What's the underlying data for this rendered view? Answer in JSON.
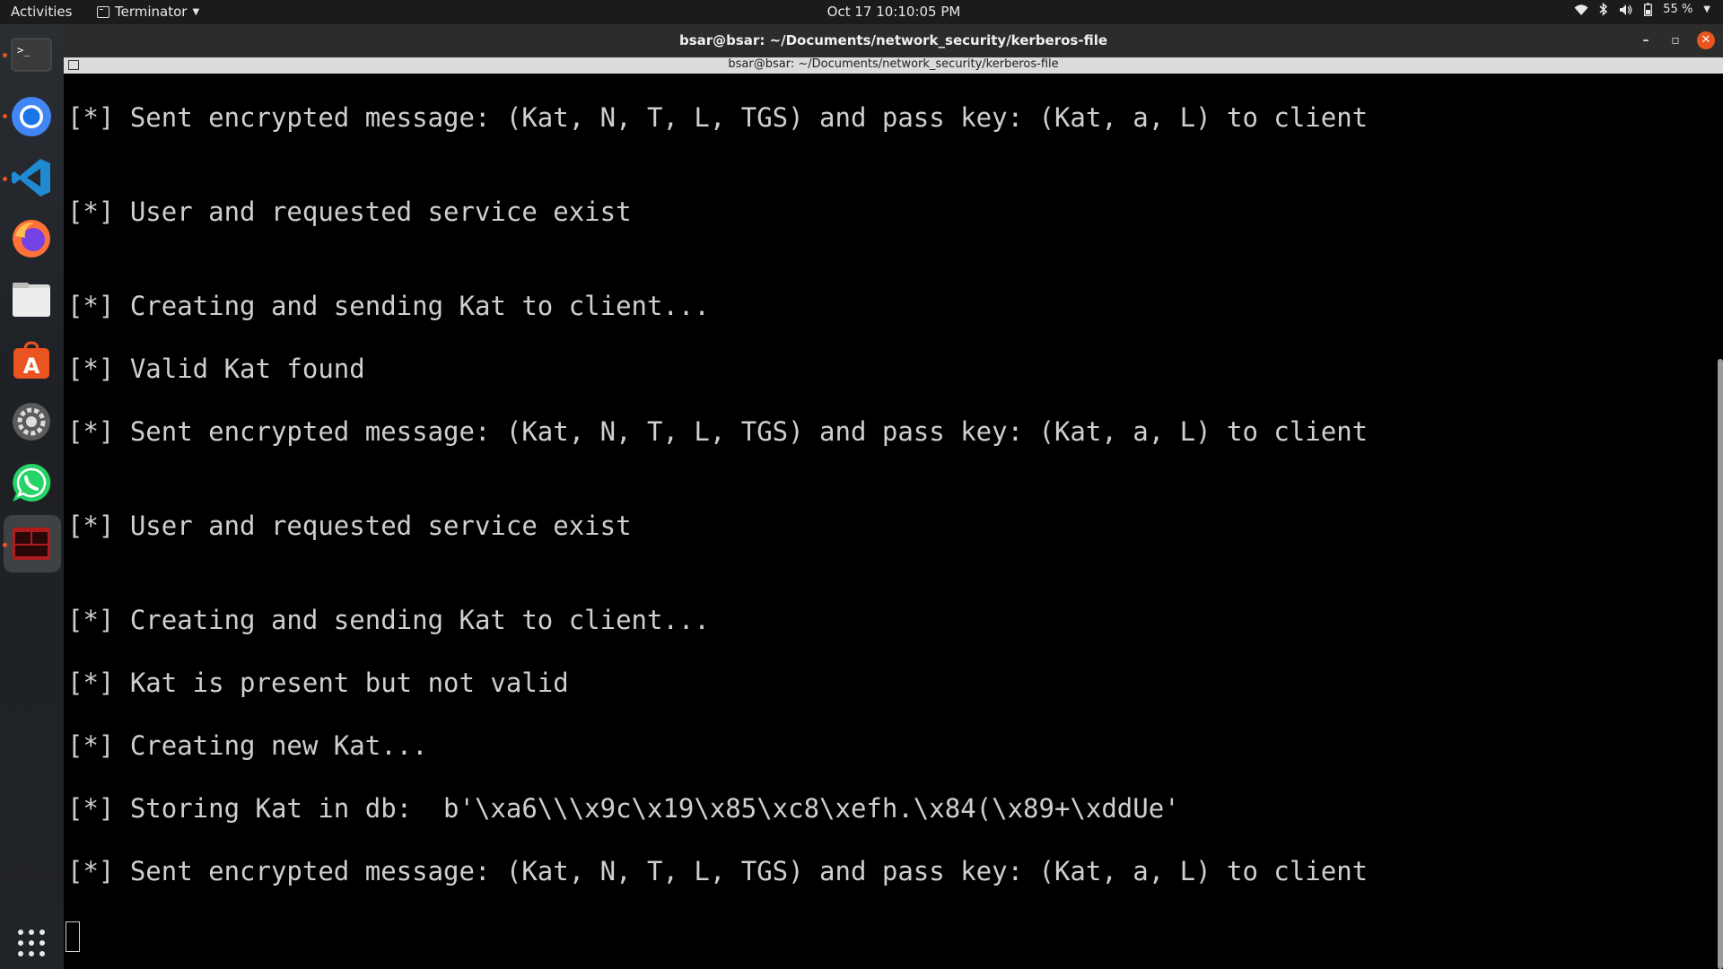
{
  "topbar": {
    "activities": "Activities",
    "app_name": "Terminator",
    "clock": "Oct 17  10:10:05 PM",
    "battery": "55 %"
  },
  "dock": {
    "items": [
      "terminal-icon",
      "chrome-icon",
      "vscode-icon",
      "firefox-icon",
      "files-icon",
      "software-icon",
      "settings-icon",
      "whatsapp-icon",
      "terminator-icon"
    ],
    "show_apps": "show-apps-icon"
  },
  "window": {
    "title": "bsar@bsar: ~/Documents/network_security/kerberos-file",
    "tab_title": "bsar@bsar: ~/Documents/network_security/kerberos-file"
  },
  "terminal": {
    "lines": [
      "[*] Sent encrypted message: (Kat, N, T, L, TGS) and pass key: (Kat, a, L) to client",
      "[*] User and requested service exist",
      "[*] Creating and sending Kat to client...",
      "[*] Valid Kat found",
      "[*] Sent encrypted message: (Kat, N, T, L, TGS) and pass key: (Kat, a, L) to client",
      "[*] User and requested service exist",
      "[*] Creating and sending Kat to client...",
      "[*] Kat is present but not valid",
      "[*] Creating new Kat...",
      "[*] Storing Kat in db:  b'\\xa6\\\\\\x9c\\x19\\x85\\xc8\\xefh.\\x84(\\x89+\\xddUe'",
      "[*] Sent encrypted message: (Kat, N, T, L, TGS) and pass key: (Kat, a, L) to client"
    ]
  }
}
